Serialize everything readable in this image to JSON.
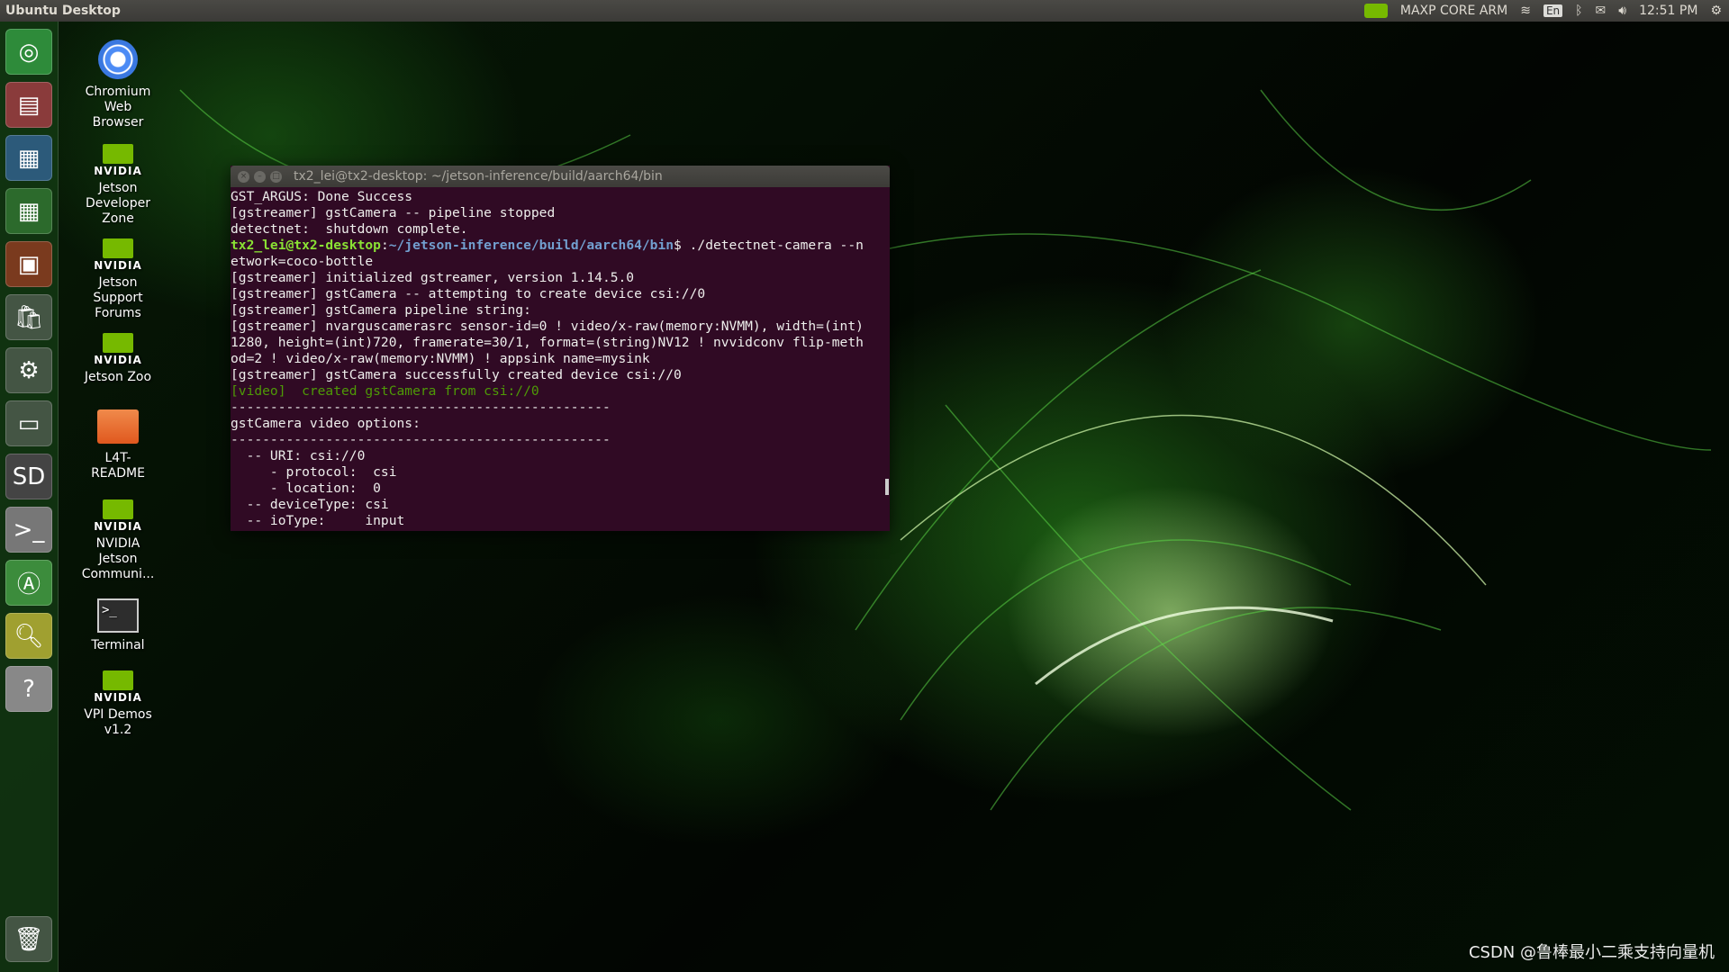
{
  "topbar": {
    "title": "Ubuntu Desktop",
    "nvpmodel": "MAXP CORE ARM",
    "keyboard": "En",
    "clock": "12:51 PM",
    "icons": [
      "nvidia-icon",
      "wifi-icon",
      "keyboard-icon",
      "bluetooth-icon",
      "mail-icon",
      "volume-icon",
      "power-gear-icon"
    ]
  },
  "launcher": {
    "items": [
      {
        "name": "ubuntu-dash",
        "color": "#2e8b3a"
      },
      {
        "name": "files",
        "color": "#8a3b3b"
      },
      {
        "name": "libreoffice-writer",
        "color": "#2c5a7a"
      },
      {
        "name": "libreoffice-calc",
        "color": "#2c6a2c"
      },
      {
        "name": "libreoffice-impress",
        "color": "#7a3a1e"
      },
      {
        "name": "software-center",
        "color": "#445544"
      },
      {
        "name": "system-settings",
        "color": "#445544"
      },
      {
        "name": "drive",
        "color": "#445544"
      },
      {
        "name": "sd-card",
        "color": "#444"
      },
      {
        "name": "terminal",
        "color": "#777"
      },
      {
        "name": "software-updater",
        "color": "#3c8c3c"
      },
      {
        "name": "image-viewer",
        "color": "#a0a030"
      },
      {
        "name": "help",
        "color": "#888"
      }
    ],
    "trash": "trash"
  },
  "desktop": {
    "icons": [
      {
        "label": "Chromium Web Browser",
        "type": "chromium"
      },
      {
        "label": "Jetson Developer Zone",
        "type": "nvidia"
      },
      {
        "label": "Jetson Support Forums",
        "type": "nvidia"
      },
      {
        "label": "Jetson Zoo",
        "type": "nvidia"
      },
      {
        "label": "L4T-README",
        "type": "folder"
      },
      {
        "label": "NVIDIA Jetson Communi...",
        "type": "nvidia"
      },
      {
        "label": "Terminal",
        "type": "terminal"
      },
      {
        "label": "VPI Demos v1.2",
        "type": "nvidia"
      }
    ],
    "nvidia_logo_text": "NVIDIA"
  },
  "terminal": {
    "title": "tx2_lei@tx2-desktop: ~/jetson-inference/build/aarch64/bin",
    "lines": [
      "GST_ARGUS: Done Success",
      "[gstreamer] gstCamera -- pipeline stopped",
      "detectnet:  shutdown complete."
    ],
    "prompt_user": "tx2_lei@tx2-desktop",
    "prompt_path": "~/jetson-inference/build/aarch64/bin",
    "command": "$ ./detectnet-camera --network=coco-bottle",
    "lines2": [
      "[gstreamer] initialized gstreamer, version 1.14.5.0",
      "[gstreamer] gstCamera -- attempting to create device csi://0",
      "[gstreamer] gstCamera pipeline string:",
      "[gstreamer] nvarguscamerasrc sensor-id=0 ! video/x-raw(memory:NVMM), width=(int)1280, height=(int)720, framerate=30/1, format=(string)NV12 ! nvvidconv flip-method=2 ! video/x-raw(memory:NVMM) ! appsink name=mysink",
      "[gstreamer] gstCamera successfully created device csi://0"
    ],
    "video_line": "[video]  created gstCamera from csi://0",
    "lines3": [
      "------------------------------------------------",
      "gstCamera video options:",
      "------------------------------------------------",
      "  -- URI: csi://0",
      "     - protocol:  csi",
      "     - location:  0",
      "  -- deviceType: csi",
      "  -- ioType:     input"
    ]
  },
  "watermark": "CSDN @鲁棒最小二乘支持向量机"
}
